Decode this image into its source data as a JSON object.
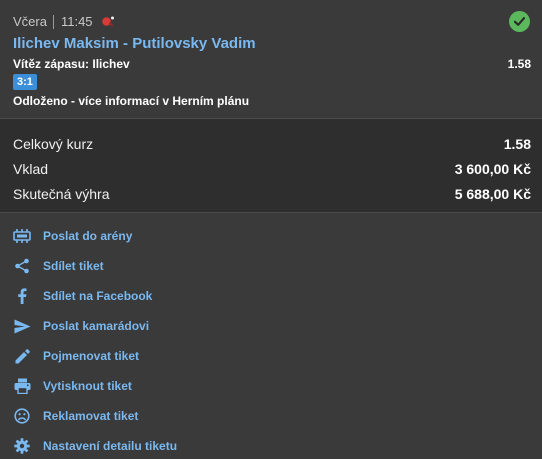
{
  "bet": {
    "day": "Včera",
    "time": "11:45",
    "match_title": "Ilichev Maksim - Putilovsky Vadim",
    "pick_label": "Vítěz zápasu: Ilichev",
    "pick_odds": "1.58",
    "score": "3:1",
    "note": "Odloženo - více informací v Herním plánu",
    "status": "won",
    "icons": {
      "sport": "table-tennis-icon",
      "status": "check-circle-icon"
    }
  },
  "summary": {
    "total_odds_label": "Celkový kurz",
    "total_odds_value": "1.58",
    "stake_label": "Vklad",
    "stake_value": "3 600,00 Kč",
    "win_label": "Skutečná výhra",
    "win_value": "5 688,00 Kč"
  },
  "actions": [
    {
      "label": "Poslat do arény",
      "icon": "arena-icon"
    },
    {
      "label": "Sdílet tiket",
      "icon": "share-icon"
    },
    {
      "label": "Sdílet na Facebook",
      "icon": "facebook-icon"
    },
    {
      "label": "Poslat kamarádovi",
      "icon": "send-icon"
    },
    {
      "label": "Pojmenovat tiket",
      "icon": "pencil-icon"
    },
    {
      "label": "Vytisknout tiket",
      "icon": "print-icon"
    },
    {
      "label": "Reklamovat tiket",
      "icon": "sad-face-icon"
    },
    {
      "label": "Nastavení detailu tiketu",
      "icon": "gear-icon"
    }
  ],
  "colors": {
    "background": "#3a3a3a",
    "summary_background": "#2e2e2e",
    "link": "#7ab8f0",
    "accent_blue": "#3a8fd8",
    "success": "#5cb85c"
  }
}
